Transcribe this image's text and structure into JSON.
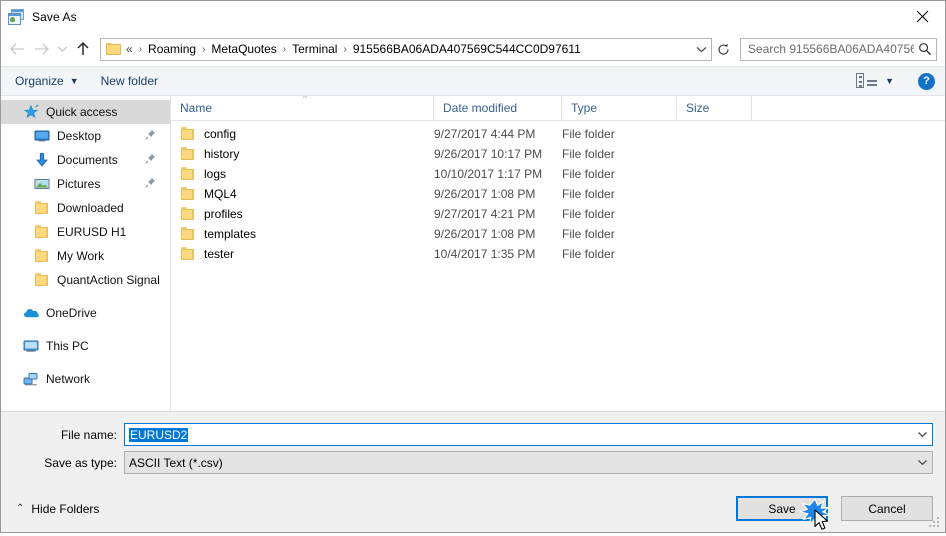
{
  "window": {
    "title": "Save As",
    "icon": "save-as-app-icon",
    "close_label": "✕"
  },
  "navigation": {
    "back": "←",
    "forward": "→",
    "recent": "⌄",
    "up": "↑",
    "back_name": "back-button",
    "forward_name": "forward-button",
    "recent_name": "recent-locations-button",
    "up_name": "up-button"
  },
  "address": {
    "lead": "«",
    "crumbs": [
      "Roaming",
      "MetaQuotes",
      "Terminal",
      "915566BA06ADA407569C544CC0D97611"
    ],
    "separator": "›",
    "dropdown": "⌄",
    "refresh": "⟳"
  },
  "search": {
    "placeholder": "Search 915566BA06ADA40756...",
    "icon": "search-icon"
  },
  "toolbar": {
    "organize_label": "Organize",
    "organize_caret": "▼",
    "new_folder_label": "New folder",
    "view_caret": "▼",
    "help_label": "?"
  },
  "sidebar": {
    "items": [
      {
        "label": "Quick access",
        "icon": "star-icon",
        "selected": true,
        "indent": false,
        "pinned": false
      },
      {
        "label": "Desktop",
        "icon": "desktop-icon",
        "selected": false,
        "indent": true,
        "pinned": true
      },
      {
        "label": "Documents",
        "icon": "documents-icon",
        "selected": false,
        "indent": true,
        "pinned": true
      },
      {
        "label": "Pictures",
        "icon": "pictures-icon",
        "selected": false,
        "indent": true,
        "pinned": true
      },
      {
        "label": "Downloaded",
        "icon": "folder-icon",
        "selected": false,
        "indent": true,
        "pinned": false
      },
      {
        "label": "EURUSD H1",
        "icon": "folder-icon",
        "selected": false,
        "indent": true,
        "pinned": false
      },
      {
        "label": "My Work",
        "icon": "folder-icon",
        "selected": false,
        "indent": true,
        "pinned": false
      },
      {
        "label": "QuantAction Signal",
        "icon": "folder-icon",
        "selected": false,
        "indent": true,
        "pinned": false
      },
      {
        "label": "OneDrive",
        "icon": "onedrive-icon",
        "selected": false,
        "indent": false,
        "pinned": false,
        "gap_before": true
      },
      {
        "label": "This PC",
        "icon": "this-pc-icon",
        "selected": false,
        "indent": false,
        "pinned": false,
        "gap_before": true
      },
      {
        "label": "Network",
        "icon": "network-icon",
        "selected": false,
        "indent": false,
        "pinned": false,
        "gap_before": true
      }
    ]
  },
  "filelist": {
    "columns": [
      "Name",
      "Date modified",
      "Type",
      "Size"
    ],
    "sort_indicator": "^",
    "rows": [
      {
        "name": "config",
        "date": "9/27/2017 4:44 PM",
        "type": "File folder",
        "size": ""
      },
      {
        "name": "history",
        "date": "9/26/2017 10:17 PM",
        "type": "File folder",
        "size": ""
      },
      {
        "name": "logs",
        "date": "10/10/2017 1:17 PM",
        "type": "File folder",
        "size": ""
      },
      {
        "name": "MQL4",
        "date": "9/26/2017 1:08 PM",
        "type": "File folder",
        "size": ""
      },
      {
        "name": "profiles",
        "date": "9/27/2017 4:21 PM",
        "type": "File folder",
        "size": ""
      },
      {
        "name": "templates",
        "date": "9/26/2017 1:08 PM",
        "type": "File folder",
        "size": ""
      },
      {
        "name": "tester",
        "date": "10/4/2017 1:35 PM",
        "type": "File folder",
        "size": ""
      }
    ]
  },
  "form": {
    "file_name_label": "File name:",
    "file_name_value": "EURUSD2",
    "save_type_label": "Save as type:",
    "save_type_value": "ASCII Text (*.csv)",
    "caret": "⌄"
  },
  "footer": {
    "hide_folders_label": "Hide Folders",
    "hide_folders_chevron": "⌃",
    "save_label": "Save",
    "cancel_label": "Cancel"
  },
  "colors": {
    "accent": "#0078d7",
    "folder": "#fcd980",
    "header_text": "#38618f",
    "selection": "#d9d9d9",
    "form_bg": "#f0f0f0"
  }
}
